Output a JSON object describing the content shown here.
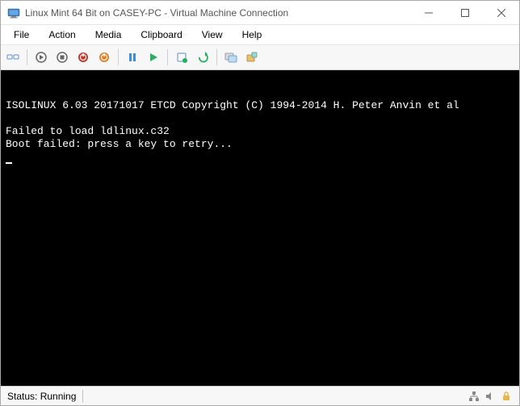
{
  "titlebar": {
    "title": "Linux Mint 64 Bit on CASEY-PC - Virtual Machine Connection"
  },
  "menu": {
    "file": "File",
    "action": "Action",
    "media": "Media",
    "clipboard": "Clipboard",
    "view": "View",
    "help": "Help"
  },
  "console": {
    "line1": "ISOLINUX 6.03 20171017 ETCD Copyright (C) 1994-2014 H. Peter Anvin et al",
    "line2": "",
    "line3": "Failed to load ldlinux.c32",
    "line4": "Boot failed: press a key to retry..."
  },
  "statusbar": {
    "text": "Status: Running"
  }
}
